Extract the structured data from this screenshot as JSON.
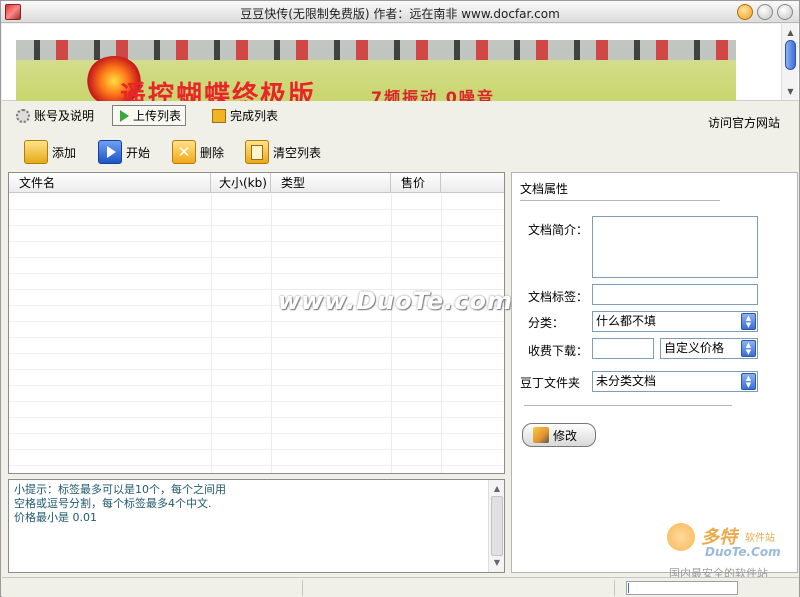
{
  "window": {
    "title": "豆豆快传(无限制免费版) 作者：远在南非  www.docfar.com"
  },
  "banner": {
    "headline": "遥控蝴蝶终极版",
    "sub": "7频振动 0噪音"
  },
  "tabs": [
    {
      "label": "账号及说明",
      "icon": "gear-icon"
    },
    {
      "label": "上传列表",
      "icon": "play-icon",
      "active": true
    },
    {
      "label": "完成列表",
      "icon": "done-icon"
    }
  ],
  "header_link": "访问官方网站",
  "toolbar": {
    "add": "添加",
    "start": "开始",
    "delete": "删除",
    "clear": "清空列表"
  },
  "file_list": {
    "columns": [
      "文件名",
      "大小(kb)",
      "类型",
      "售价",
      ""
    ],
    "rows": []
  },
  "tips": {
    "line1": "小提示：标签最多可以是10个，每个之间用",
    "line2": "空格或逗号分割，每个标签最多4个中文.",
    "line3": "价格最小是 0.01"
  },
  "properties": {
    "title": "文档属性",
    "desc_label": "文档简介：",
    "desc_value": "",
    "tags_label": "文档标签：",
    "tags_value": "",
    "category_label": "分类：",
    "category_value": "什么都不填",
    "fee_label": "收费下载：",
    "fee_value": "",
    "price_mode_value": "自定义价格",
    "folder_label": "豆丁文件夹",
    "folder_value": "未分类文档",
    "modify_button": "修改"
  },
  "watermark": "www.DuoTe.com",
  "site_logo": {
    "big": "多特",
    "small": "软件站",
    "domain": "DuoTe.Com",
    "slogan": "国内最安全的软件站"
  },
  "colors": {
    "accent_blue": "#3c6ed4",
    "tips_text": "#1f5a6e",
    "window_bg": "#f0efe8"
  }
}
